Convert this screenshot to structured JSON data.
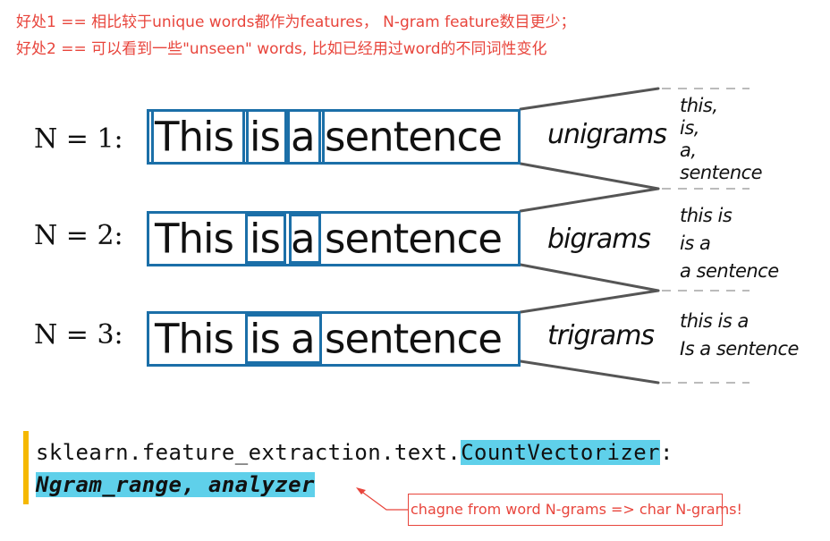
{
  "notes": {
    "line1": "好处1 == 相比较于unique words都作为features， N-gram feature数目更少；",
    "line2": "好处2 == 可以看到一些\"unseen\" words, 比如已经用过word的不同词性变化"
  },
  "rows": [
    {
      "n_label": "N = 1:",
      "tokens": [
        "This",
        "is",
        "a",
        "sentence"
      ],
      "gram_label": "unigrams",
      "examples": [
        "this,",
        "is,",
        "a,",
        "sentence"
      ]
    },
    {
      "n_label": "N = 2:",
      "tokens": [
        "This",
        "is",
        "a",
        "sentence"
      ],
      "gram_label": "bigrams",
      "examples": [
        "this is",
        "is a",
        "a sentence"
      ]
    },
    {
      "n_label": "N = 3:",
      "tokens": [
        "This",
        "is",
        "a",
        "sentence"
      ],
      "gram_label": "trigrams",
      "examples": [
        "this is a",
        "Is a sentence"
      ]
    }
  ],
  "code": {
    "line1_prefix": "sklearn.feature_extraction.text.",
    "line1_highlight": "CountVectorizer",
    "line1_suffix": ":",
    "line2": "Ngram_range, analyzer"
  },
  "callout": "chagne from word N-grams => char N-grams!",
  "colors": {
    "note_red": "#e8453c",
    "token_box_blue": "#1b6fa8",
    "code_highlight": "#5fd0ea",
    "code_bar_yellow": "#f5b800",
    "connector_gray": "#555555"
  }
}
